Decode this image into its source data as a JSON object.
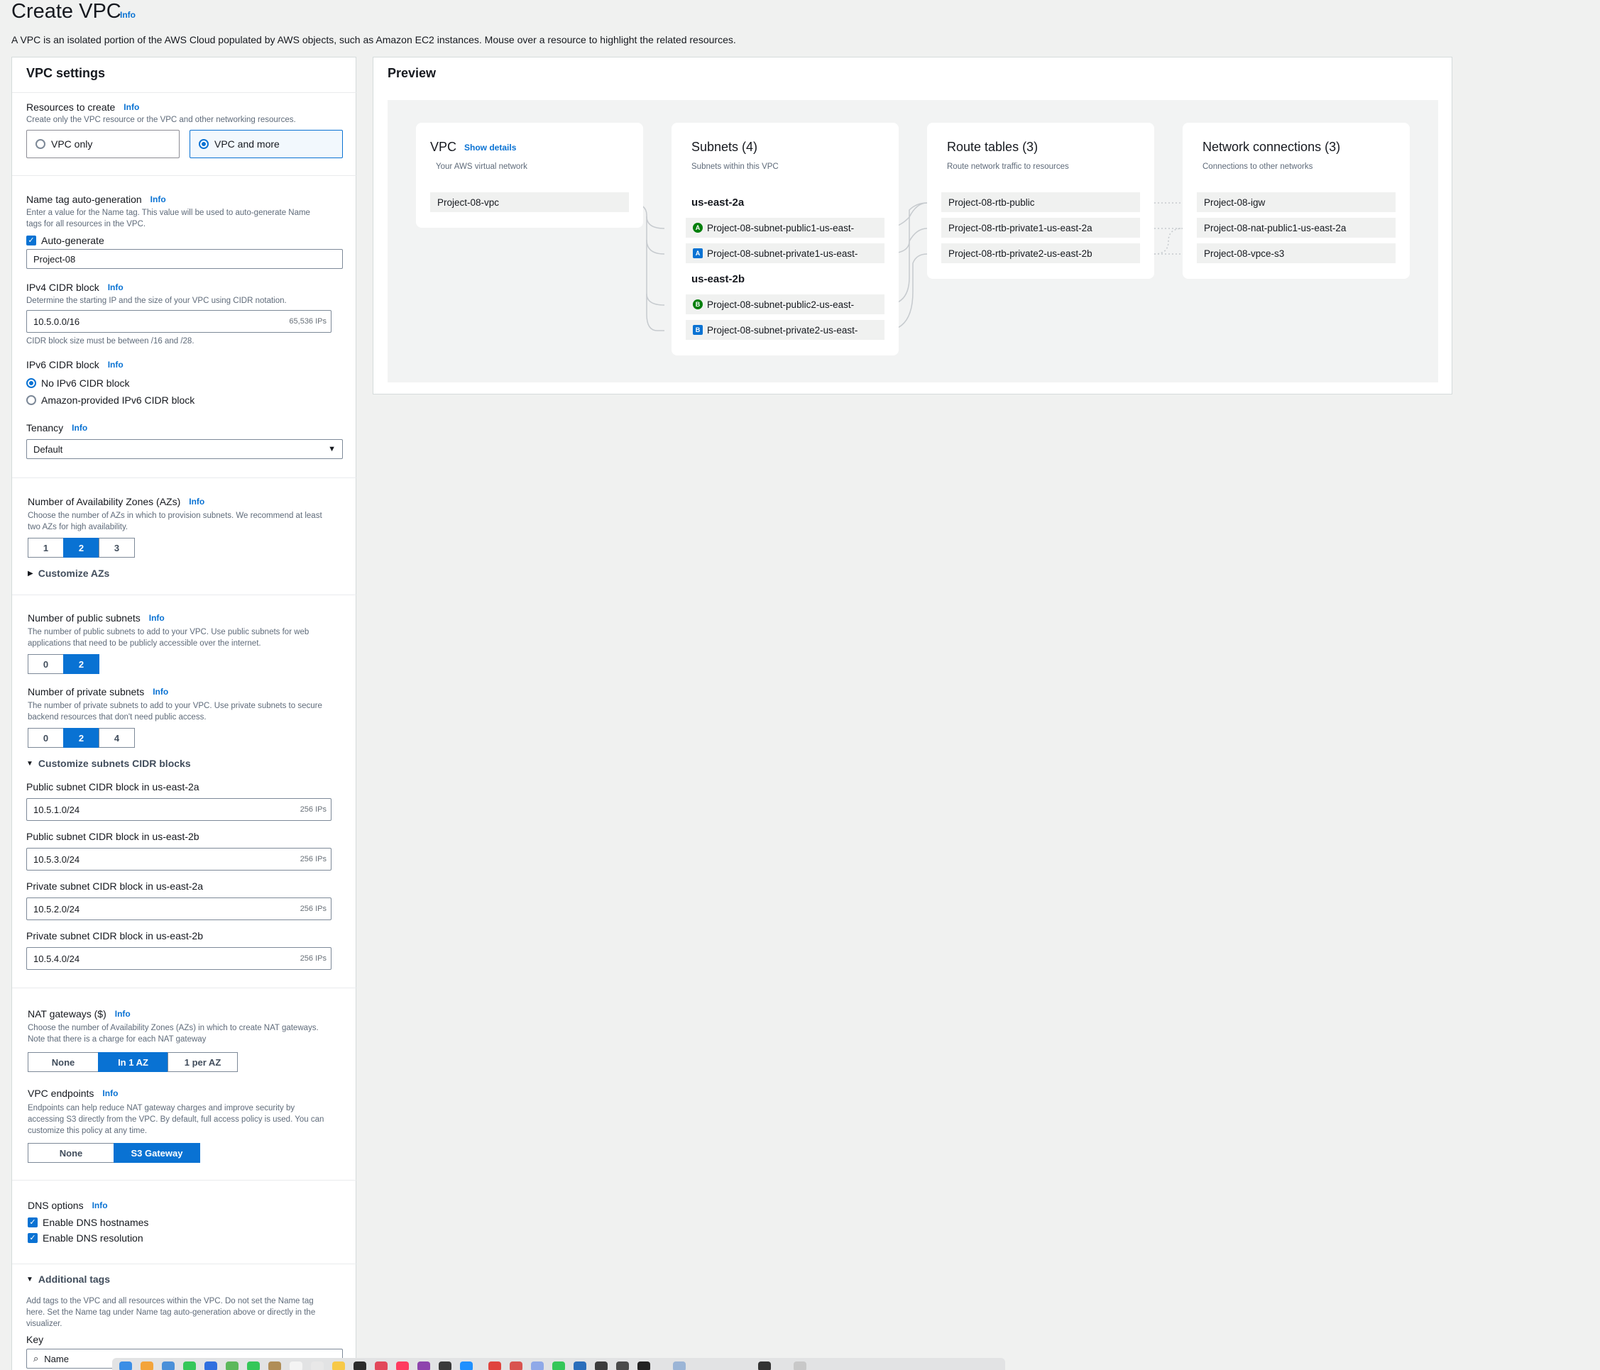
{
  "header": {
    "title": "Create VPC",
    "info": "Info",
    "description": "A VPC is an isolated portion of the AWS Cloud populated by AWS objects, such as Amazon EC2 instances. Mouse over a resource to highlight the related resources."
  },
  "settings": {
    "title": "VPC settings",
    "resources": {
      "label": "Resources to create",
      "info": "Info",
      "desc": "Create only the VPC resource or the VPC and other networking resources.",
      "options": [
        "VPC only",
        "VPC and more"
      ],
      "selected": "VPC and more"
    },
    "name_tag": {
      "label": "Name tag auto-generation",
      "info": "Info",
      "desc1": "Enter a value for the Name tag. This value will be used to auto-generate Name",
      "desc2": "tags for all resources in the VPC.",
      "checkbox": "Auto-generate",
      "value": "Project-08"
    },
    "ipv4": {
      "label": "IPv4 CIDR block",
      "info": "Info",
      "desc": "Determine the starting IP and the size of your VPC using CIDR notation.",
      "value": "10.5.0.0/16",
      "hint": "65,536 IPs",
      "note": "CIDR block size must be between /16 and /28."
    },
    "ipv6": {
      "label": "IPv6 CIDR block",
      "info": "Info",
      "options": [
        "No IPv6 CIDR block",
        "Amazon-provided IPv6 CIDR block"
      ],
      "selected": "No IPv6 CIDR block"
    },
    "tenancy": {
      "label": "Tenancy",
      "info": "Info",
      "value": "Default"
    },
    "azs": {
      "label": "Number of Availability Zones (AZs)",
      "info": "Info",
      "desc1": "Choose the number of AZs in which to provision subnets. We recommend at least",
      "desc2": "two AZs for high availability.",
      "options": [
        "1",
        "2",
        "3"
      ],
      "selected": "2",
      "customize": "Customize AZs"
    },
    "public_subnets": {
      "label": "Number of public subnets",
      "info": "Info",
      "desc1": "The number of public subnets to add to your VPC. Use public subnets for web",
      "desc2": "applications that need to be publicly accessible over the internet.",
      "options": [
        "0",
        "2"
      ],
      "selected": "2"
    },
    "private_subnets": {
      "label": "Number of private subnets",
      "info": "Info",
      "desc1": "The number of private subnets to add to your VPC. Use private subnets to secure",
      "desc2": "backend resources that don't need public access.",
      "options": [
        "0",
        "2",
        "4"
      ],
      "selected": "2"
    },
    "customize_cidr": {
      "label": "Customize subnets CIDR blocks",
      "fields": [
        {
          "label": "Public subnet CIDR block in us-east-2a",
          "value": "10.5.1.0/24",
          "hint": "256 IPs"
        },
        {
          "label": "Public subnet CIDR block in us-east-2b",
          "value": "10.5.3.0/24",
          "hint": "256 IPs"
        },
        {
          "label": "Private subnet CIDR block in us-east-2a",
          "value": "10.5.2.0/24",
          "hint": "256 IPs"
        },
        {
          "label": "Private subnet CIDR block in us-east-2b",
          "value": "10.5.4.0/24",
          "hint": "256 IPs"
        }
      ]
    },
    "nat": {
      "label": "NAT gateways ($)",
      "info": "Info",
      "desc1": "Choose the number of Availability Zones (AZs) in which to create NAT gateways.",
      "desc2": "Note that there is a charge for each NAT gateway",
      "options": [
        "None",
        "In 1 AZ",
        "1 per AZ"
      ],
      "selected": "In 1 AZ"
    },
    "endpoints": {
      "label": "VPC endpoints",
      "info": "Info",
      "desc1": "Endpoints can help reduce NAT gateway charges and improve security by",
      "desc2": "accessing S3 directly from the VPC. By default, full access policy is used. You can",
      "desc3": "customize this policy at any time.",
      "options": [
        "None",
        "S3 Gateway"
      ],
      "selected": "S3 Gateway"
    },
    "dns": {
      "label": "DNS options",
      "info": "Info",
      "options": [
        "Enable DNS hostnames",
        "Enable DNS resolution"
      ]
    },
    "tags": {
      "label": "Additional tags",
      "desc1": "Add tags to the VPC and all resources within the VPC. Do not set the Name tag",
      "desc2": "here. Set the Name tag under Name tag auto-generation above or directly in the",
      "desc3": "visualizer.",
      "key_label": "Key",
      "key_value": "Name"
    }
  },
  "preview": {
    "title": "Preview",
    "vpc": {
      "title": "VPC",
      "link": "Show details",
      "sub": "Your AWS virtual network",
      "item": "Project-08-vpc"
    },
    "subnets": {
      "title": "Subnets (4)",
      "sub": "Subnets within this VPC",
      "az1": "us-east-2a",
      "az2": "us-east-2b",
      "items": [
        {
          "badge": "A",
          "kind": "public",
          "name": "Project-08-subnet-public1-us-east-"
        },
        {
          "badge": "A",
          "kind": "private",
          "name": "Project-08-subnet-private1-us-east-"
        },
        {
          "badge": "B",
          "kind": "public",
          "name": "Project-08-subnet-public2-us-east-"
        },
        {
          "badge": "B",
          "kind": "private",
          "name": "Project-08-subnet-private2-us-east-"
        }
      ]
    },
    "route_tables": {
      "title": "Route tables (3)",
      "sub": "Route network traffic to resources",
      "items": [
        "Project-08-rtb-public",
        "Project-08-rtb-private1-us-east-2a",
        "Project-08-rtb-private2-us-east-2b"
      ]
    },
    "network": {
      "title": "Network connections (3)",
      "sub": "Connections to other networks",
      "items": [
        "Project-08-igw",
        "Project-08-nat-public1-us-east-2a",
        "Project-08-vpce-s3"
      ]
    }
  },
  "colors": {
    "accent": "#0972d3",
    "public_badge": "#037f0c",
    "private_badge": "#0972d3"
  }
}
